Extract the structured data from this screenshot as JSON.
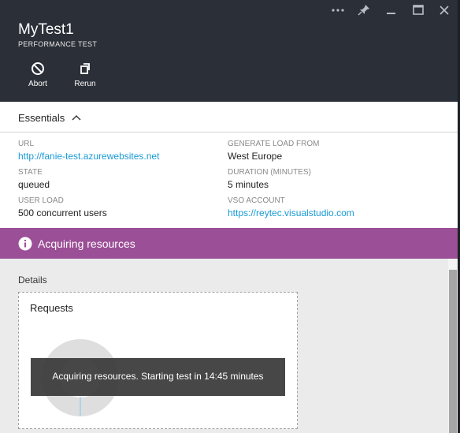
{
  "blade": {
    "title": "MyTest1",
    "subtitle": "PERFORMANCE TEST",
    "window_controls": [
      "more-icon",
      "pin-icon",
      "minimize-icon",
      "maximize-icon",
      "close-icon"
    ]
  },
  "commands": [
    {
      "label": "Abort",
      "icon": "abort-icon"
    },
    {
      "label": "Rerun",
      "icon": "rerun-icon"
    }
  ],
  "essentials": {
    "title": "Essentials",
    "left": [
      {
        "label": "URL",
        "value": "http://fanie-test.azurewebsites.net",
        "link": true
      },
      {
        "label": "STATE",
        "value": "queued"
      },
      {
        "label": "USER LOAD",
        "value": "500 concurrent users"
      }
    ],
    "right": [
      {
        "label": "GENERATE LOAD FROM",
        "value": "West Europe"
      },
      {
        "label": "DURATION (MINUTES)",
        "value": "5 minutes"
      },
      {
        "label": "VSO ACCOUNT",
        "value": "https://reytec.visualstudio.com",
        "link": true
      }
    ]
  },
  "notification": {
    "text": "Acquiring resources",
    "icon": "info-icon",
    "color": "#9b4f96"
  },
  "details": {
    "label": "Details",
    "tile_title": "Requests",
    "toast": "Acquiring resources. Starting test in 14:45 minutes"
  },
  "colors": {
    "header": "#2b2f38",
    "link": "#1a9ad6",
    "accent": "#9b4f96"
  }
}
